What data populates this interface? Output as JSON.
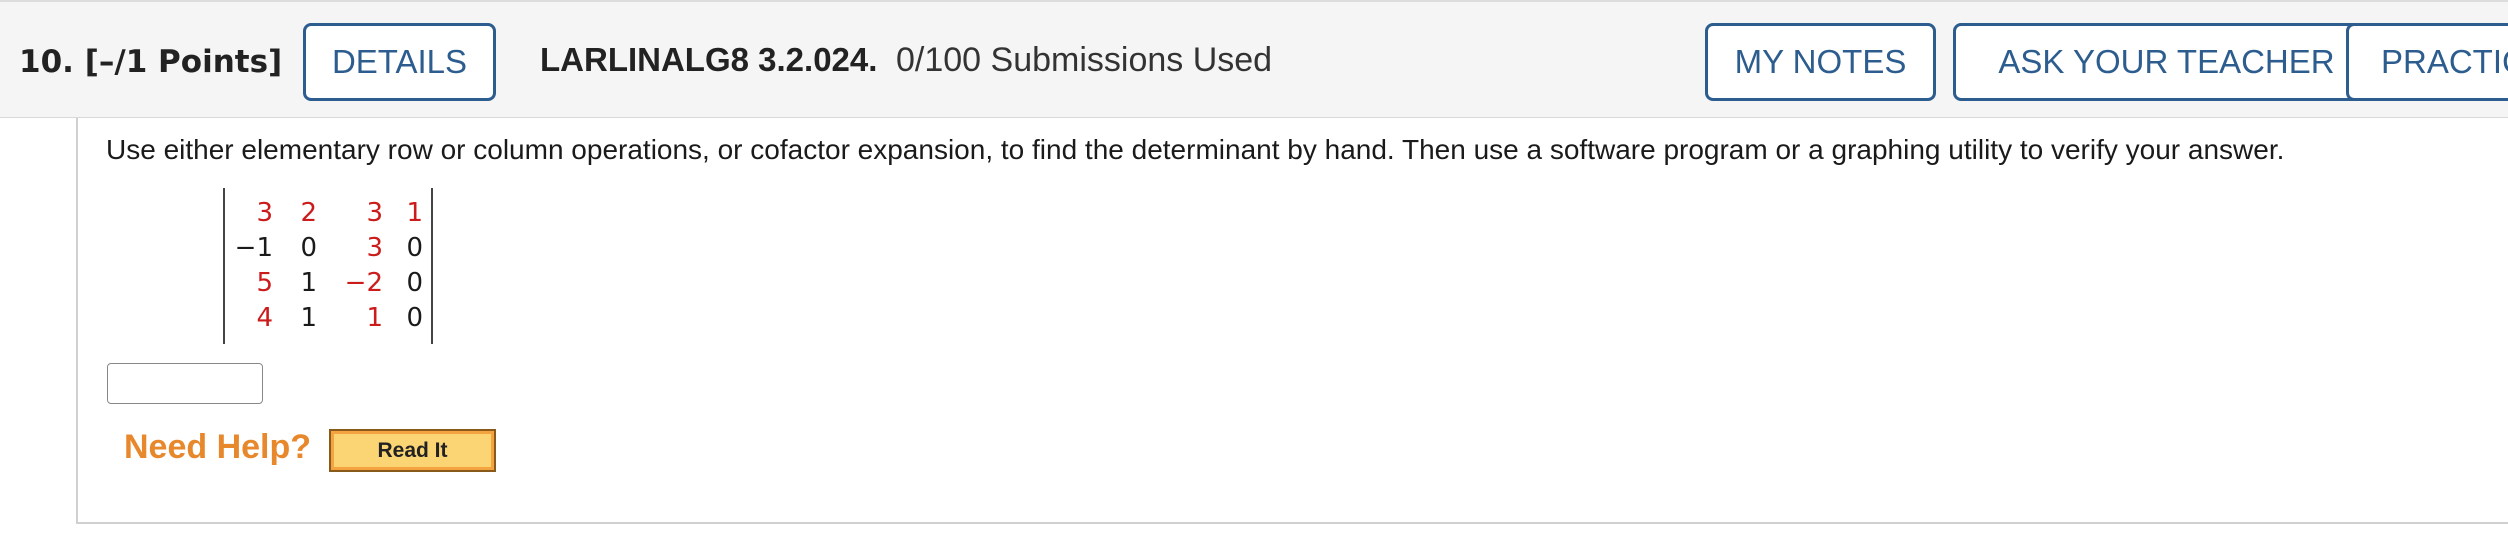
{
  "question": {
    "number_points": "10.  [–/1 Points]",
    "details_label": "DETAILS",
    "code": "LARLINALG8 3.2.024.",
    "submissions": "0/100 Submissions Used",
    "my_notes_label": "MY NOTES",
    "ask_teacher_label": "ASK YOUR TEACHER",
    "practice_label": "PRACTIC"
  },
  "body": {
    "instruction": "Use either elementary row or column operations, or cofactor expansion, to find the determinant by hand. Then use a software program or a graphing utility to verify your answer.",
    "matrix": [
      [
        "3",
        "2",
        "3",
        "1"
      ],
      [
        "−1",
        "0",
        "3",
        "0"
      ],
      [
        "5",
        "1",
        "−2",
        "0"
      ],
      [
        "4",
        "1",
        "1",
        "0"
      ]
    ],
    "answer_value": "",
    "need_help": "Need Help?",
    "read_it": "Read It"
  },
  "colors": {
    "button_border": "#2d5d8f",
    "matrix_highlight": "#cc1b1b",
    "need_help": "#e8882c",
    "read_it_fill": "#fbd474"
  }
}
